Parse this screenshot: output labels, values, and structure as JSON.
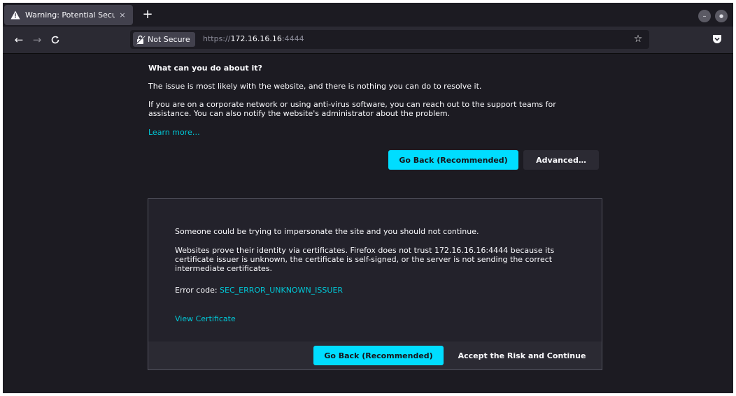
{
  "tab": {
    "title": "Warning: Potential Secu",
    "close": "×",
    "new_tab": "+"
  },
  "window_controls": {
    "minimize": "–",
    "close": "●"
  },
  "nav": {
    "back": "←",
    "forward": "→",
    "reload": "C"
  },
  "urlbar": {
    "not_secure": "Not Secure",
    "scheme": "https://",
    "host": "172.16.16.16",
    "port": ":4444",
    "bookmark": "☆"
  },
  "page": {
    "heading": "What can you do about it?",
    "para1": "The issue is most likely with the website, and there is nothing you can do to resolve it.",
    "para2": "If you are on a corporate network or using anti-virus software, you can reach out to the support teams for assistance. You can also notify the website's administrator about the problem.",
    "learn_more": "Learn more…",
    "go_back": "Go Back (Recommended)",
    "advanced": "Advanced…"
  },
  "advanced": {
    "line1": "Someone could be trying to impersonate the site and you should not continue.",
    "line2": "Websites prove their identity via certificates. Firefox does not trust 172.16.16.16:4444 because its certificate issuer is unknown, the certificate is self-signed, or the server is not sending the correct intermediate certificates.",
    "error_label": "Error code: ",
    "error_code": "SEC_ERROR_UNKNOWN_ISSUER",
    "view_certificate": "View Certificate",
    "go_back": "Go Back (Recommended)",
    "accept": "Accept the Risk and Continue"
  },
  "colors": {
    "background": "#1c1b22",
    "accent": "#00ddff",
    "link": "#00c8d7",
    "toolbar": "#2b2a33"
  }
}
